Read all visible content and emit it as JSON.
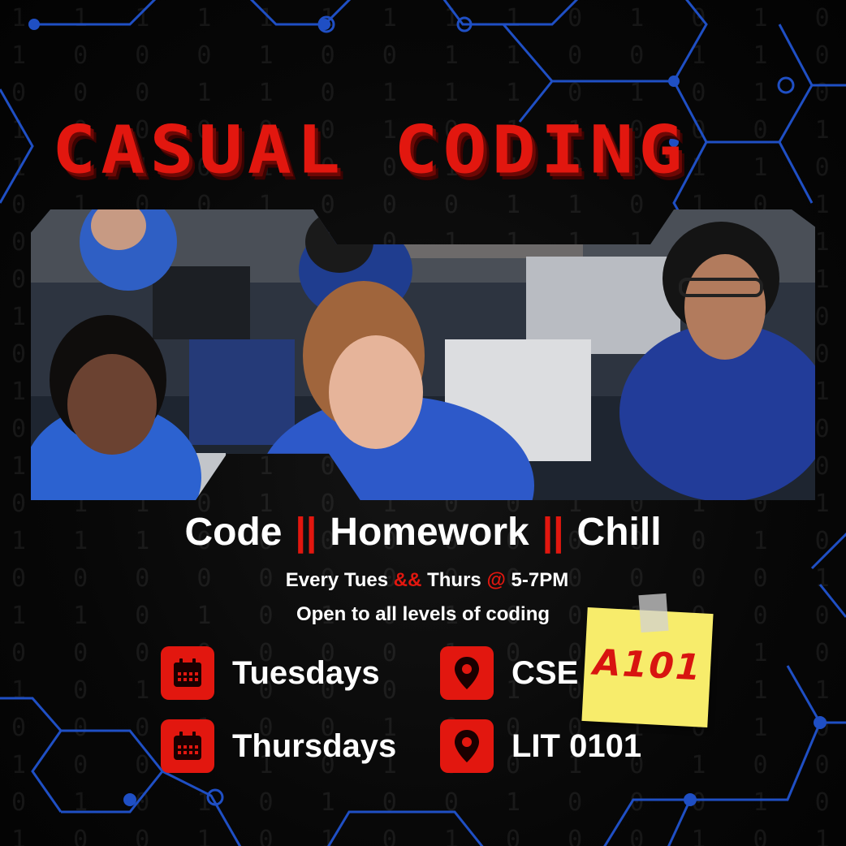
{
  "title": "CASUAL CODING",
  "tagline": {
    "part1": "Code",
    "separator": "||",
    "part2": "Homework",
    "part3": "Chill"
  },
  "schedule_line": {
    "prefix": "Every Tues",
    "amp": "&&",
    "mid": "Thurs",
    "at": "@",
    "time": "5-7PM"
  },
  "audience_line": "Open to all levels of coding",
  "days": [
    {
      "label": "Tuesdays",
      "icon": "calendar-icon"
    },
    {
      "label": "Thursdays",
      "icon": "calendar-icon"
    }
  ],
  "locations": [
    {
      "label": "CSE",
      "icon": "location-pin-icon"
    },
    {
      "label": "LIT 0101",
      "icon": "location-pin-icon"
    }
  ],
  "sticky_note": {
    "text": "A101"
  },
  "colors": {
    "accent": "#e2170f",
    "circuit": "#1f4fc4",
    "sticky": "#f7ec6b",
    "background": "#050505"
  }
}
